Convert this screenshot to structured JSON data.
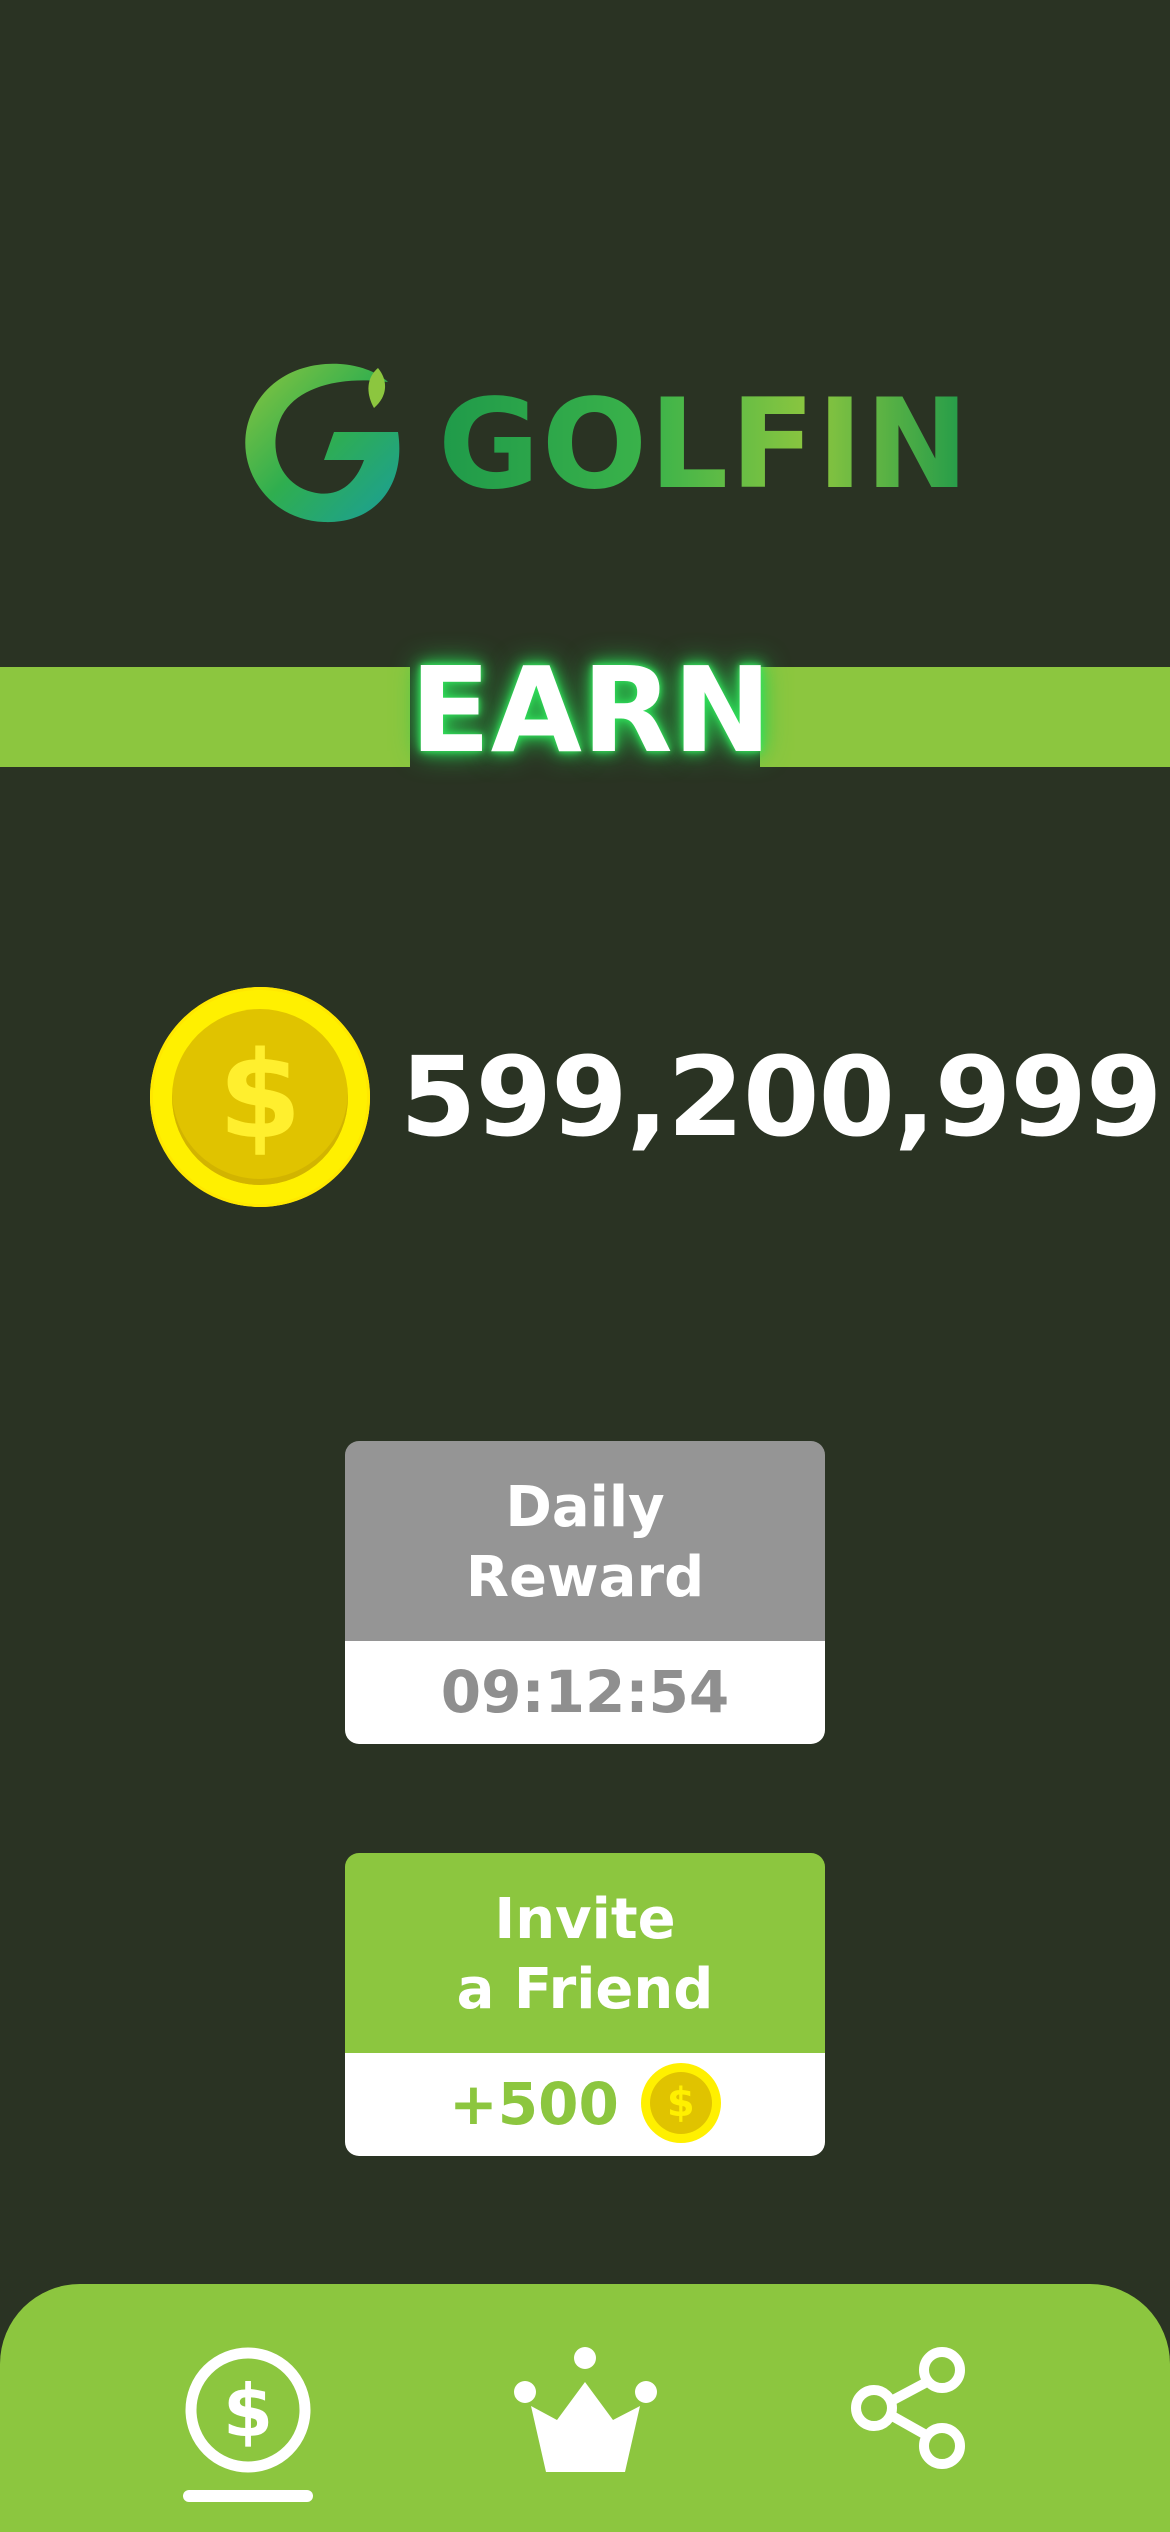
{
  "brand": {
    "name": "GOLFIN",
    "logo_icon": "golfin-g-logo"
  },
  "section": {
    "title": "EARN"
  },
  "balance": {
    "value": "599,200,999",
    "icon": "coin-icon"
  },
  "cards": {
    "daily_reward": {
      "title_line1": "Daily",
      "title_line2": "Reward",
      "timer": "09:12:54"
    },
    "invite_friend": {
      "title_line1": "Invite",
      "title_line2": "a Friend",
      "reward": "+500",
      "reward_icon": "coin-icon"
    }
  },
  "tabbar": {
    "tabs": [
      {
        "icon": "earn-dollar-icon",
        "selected": true
      },
      {
        "icon": "crown-icon",
        "selected": false
      },
      {
        "icon": "share-icon",
        "selected": false
      }
    ]
  },
  "colors": {
    "background": "#2a3323",
    "accent_green": "#8cc63f",
    "coin_yellow": "#fff000",
    "card_gray": "#959595"
  }
}
